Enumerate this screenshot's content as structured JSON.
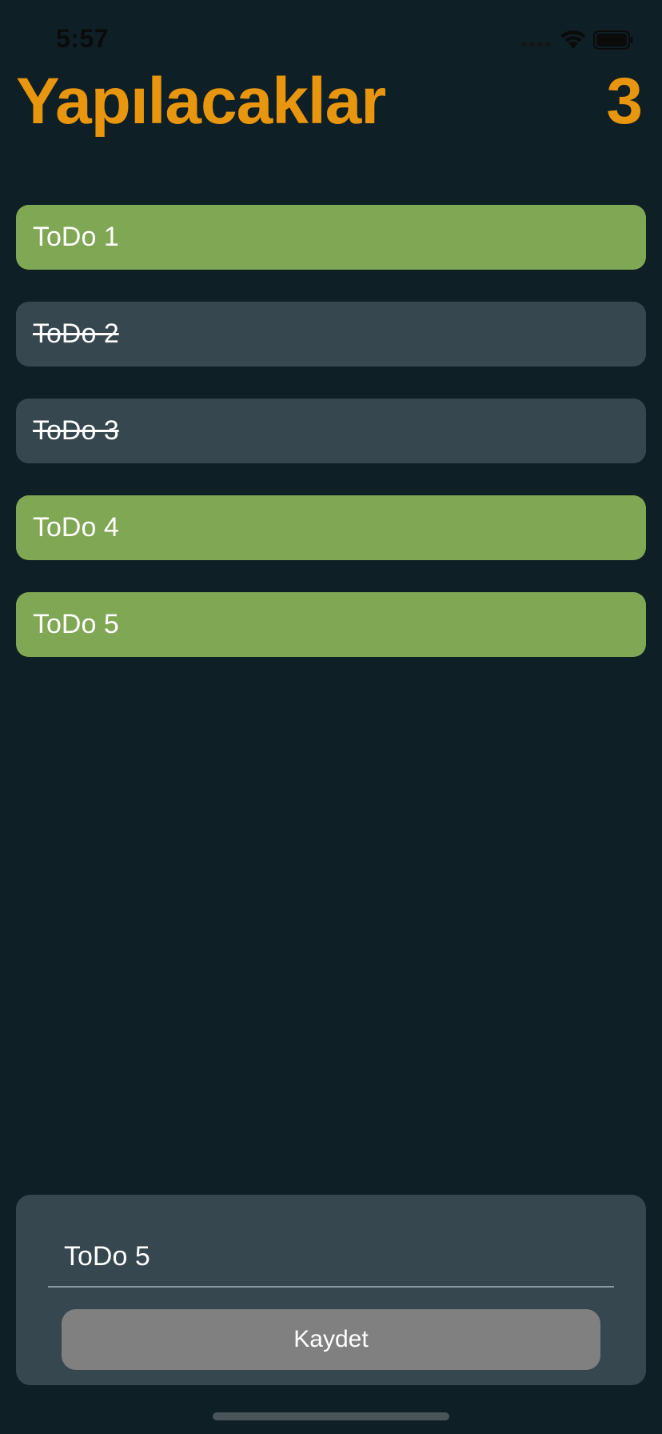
{
  "status_bar": {
    "time": "5:57",
    "icons": [
      "signal-icon",
      "wifi-icon",
      "battery-icon"
    ]
  },
  "header": {
    "title": "Yapılacaklar",
    "count": "3"
  },
  "todos": [
    {
      "label": "ToDo 1",
      "done": false
    },
    {
      "label": "ToDo 2",
      "done": true
    },
    {
      "label": "ToDo 3",
      "done": true
    },
    {
      "label": "ToDo 4",
      "done": false
    },
    {
      "label": "ToDo 5",
      "done": false
    }
  ],
  "input_panel": {
    "input_value": "ToDo 5",
    "save_label": "Kaydet"
  },
  "colors": {
    "background": "#0f1f26",
    "accent": "#e9960f",
    "active_item": "#80a754",
    "done_item": "#37474f",
    "panel": "#37474f",
    "button": "#808080"
  }
}
